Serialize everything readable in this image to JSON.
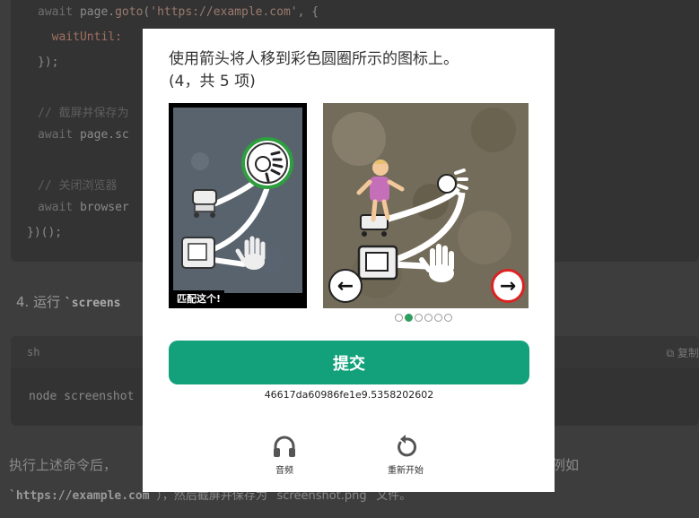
{
  "background": {
    "code_lines": [
      {
        "kw": "await ",
        "text": "page.",
        "fn": "goto",
        "rest": "(",
        "str": "'https://example.com'",
        "tail": ", {"
      },
      {
        "kw": "",
        "text": "  waitUntil: ",
        "fn": "",
        "rest": "",
        "str": "",
        "tail": ""
      },
      {
        "kw": "",
        "text": "});",
        "fn": "",
        "rest": "",
        "str": "",
        "tail": ""
      },
      {
        "kw": "",
        "text": "// 截屏并保存为",
        "fn": "",
        "rest": "",
        "str": "",
        "tail": ""
      },
      {
        "kw": "await ",
        "text": "page.sc",
        "fn": "",
        "rest": "",
        "str": "",
        "tail": ""
      },
      {
        "kw": "",
        "text": "// 关闭浏览器",
        "fn": "",
        "rest": "",
        "str": "",
        "tail": ""
      },
      {
        "kw": "await ",
        "text": "browser",
        "fn": "",
        "rest": "",
        "str": "",
        "tail": ""
      },
      {
        "kw": "",
        "text": "})();",
        "fn": "",
        "rest": "",
        "str": "",
        "tail": ""
      }
    ],
    "step_number": "4.",
    "step_text": "运行",
    "step_code": "`screens",
    "sh_lang": "sh",
    "copy_label": "复制",
    "sh_command": "node screenshot",
    "para1_left": "执行上述命令后，",
    "para1_right": "（例如",
    "para2_code": "`https://example.com`",
    "para2_text": "），然后截屏并保存为 `screenshot.png` 文件。"
  },
  "captcha": {
    "prompt": "使用箭头将人移到彩色圆圈所示的图标上。",
    "progress": "(4，共 5 项)",
    "reference_label": "匹配这个!",
    "nav_left": "←",
    "nav_right": "→",
    "pages_total": 6,
    "pages_current": 2,
    "submit_label": "提交",
    "session_id": "46617da60986fe1e9.5358202602",
    "audio_label": "音频",
    "restart_label": "重新开始",
    "icons": [
      "person-icon",
      "cart-icon",
      "safe-icon",
      "hand-icon",
      "sun-icon"
    ],
    "colors": {
      "accent": "#12a17b",
      "target_ring": "#2e9e3e",
      "right_arrow_ring": "#dd2222",
      "active_dot": "#2e9e5e"
    }
  }
}
